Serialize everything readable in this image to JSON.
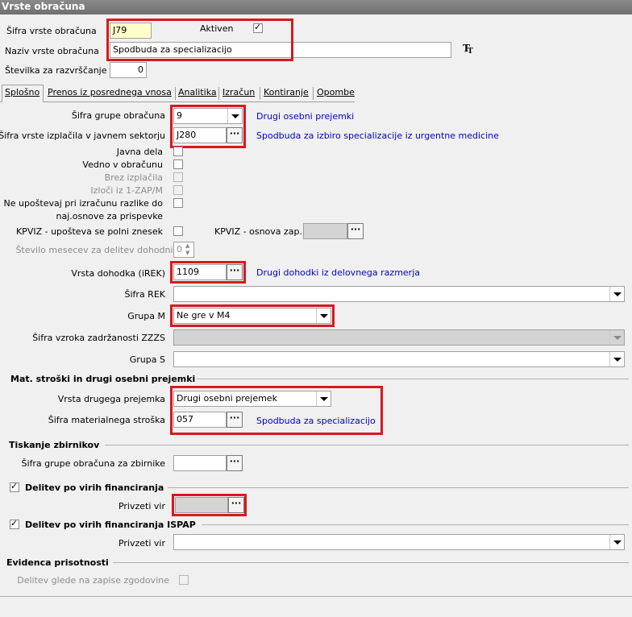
{
  "window": {
    "title": "Vrste obračuna"
  },
  "header": {
    "code_label": "Šifra vrste obračuna",
    "code_value": "J79",
    "active_label": "Aktiven",
    "name_label": "Naziv vrste obračuna",
    "name_value": "Spodbuda za specializacijo",
    "sort_label": "Številka  za razvrščanje",
    "sort_value": "0"
  },
  "tabs": [
    "Splošno",
    "Prenos iz posrednega vnosa",
    "Analitika",
    "Izračun",
    "Kontiranje",
    "Opombe"
  ],
  "general": {
    "group_label": "Šifra grupe obračuna",
    "group_value": "9",
    "group_desc": "Drugi osebni prejemki",
    "payout_label": "Šifra vrste izplačila v javnem sektorju",
    "payout_value": "J280",
    "payout_desc": "Spodbuda za izbiro specializacije iz urgentne medicine",
    "javna_dela": "Javna dela",
    "vedno": "Vedno v obračunu",
    "brez": "Brez izplačila",
    "izloci": "Izloči iz 1-ZAP/M",
    "ne_upostevaj_1": "Ne upoštevaj pri izračunu razlike do",
    "ne_upostevaj_2": "naj.osnove za prispevke",
    "kpviz_label": "KPVIZ - upošteva se polni znesek",
    "kpviz_osnova_label": "KPVIZ - osnova zap.",
    "months_label": "Število mesecev za delitev dohodnine:",
    "months_value": "0",
    "income_label": "Vrsta dohodka (iREK)",
    "income_value": "1109",
    "income_desc": "Drugi dohodki iz delovnega razmerja",
    "rek_label": "Šifra REK",
    "rek_value": "",
    "m_label": "Grupa M",
    "m_value": "Ne gre v M4",
    "zzzs_label": "Šifra vzroka zadržanosti ZZZS",
    "s_label": "Grupa S",
    "s_value": ""
  },
  "mat": {
    "section": "Mat. stroški in drugi osebni prejemki",
    "type_label": "Vrsta drugega prejemka",
    "type_value": "Drugi osebni prejemek",
    "cost_label": "Šifra materialnega stroška",
    "cost_value": "057",
    "cost_desc": "Spodbuda za specializacijo"
  },
  "print": {
    "section": "Tiskanje zbirnikov",
    "group_label": "Šifra grupe obračuna za zbirnike"
  },
  "fin": {
    "section": "Delitev po virih financiranja",
    "source_label": "Privzeti vir"
  },
  "ispap": {
    "section": "Delitev po virih financiranja ISPAP",
    "source_label": "Privzeti vir"
  },
  "presence": {
    "section": "Evidenca prisotnosti",
    "history_label": "Delitev glede na zapise zgodovine"
  },
  "colors": {
    "highlight": "#d7191c",
    "link": "#0000cc"
  }
}
